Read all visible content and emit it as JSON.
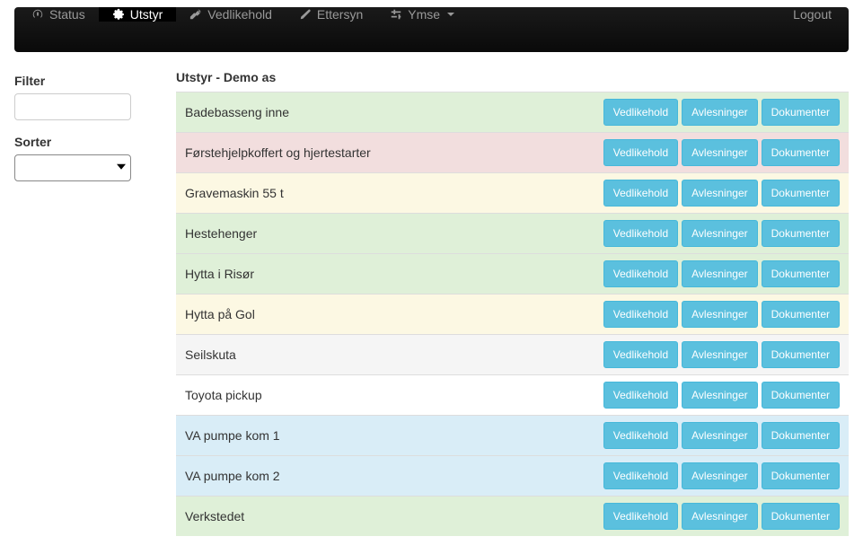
{
  "nav": {
    "status": "Status",
    "utstyr": "Utstyr",
    "vedlikehold": "Vedlikehold",
    "ettersyn": "Ettersyn",
    "ymse": "Ymse",
    "logout": "Logout"
  },
  "sidebar": {
    "filter_label": "Filter",
    "sorter_label": "Sorter"
  },
  "page": {
    "title": "Utstyr - Demo as"
  },
  "buttons": {
    "vedlikehold": "Vedlikehold",
    "avlesninger": "Avlesninger",
    "dokumenter": "Dokumenter"
  },
  "rows": [
    {
      "name": "Badebasseng inne",
      "cls": "row-green"
    },
    {
      "name": "Førstehjelpkoffert og hjertestarter",
      "cls": "row-pink"
    },
    {
      "name": "Gravemaskin 55 t",
      "cls": "row-yellow"
    },
    {
      "name": "Hestehenger",
      "cls": "row-green"
    },
    {
      "name": "Hytta i Risør",
      "cls": "row-green"
    },
    {
      "name": "Hytta på Gol",
      "cls": "row-yellow"
    },
    {
      "name": "Seilskuta",
      "cls": "row-gray"
    },
    {
      "name": "Toyota pickup",
      "cls": "row-white"
    },
    {
      "name": "VA pumpe kom 1",
      "cls": "row-blue"
    },
    {
      "name": "VA pumpe kom 2",
      "cls": "row-blue"
    },
    {
      "name": "Verkstedet",
      "cls": "row-green"
    }
  ]
}
